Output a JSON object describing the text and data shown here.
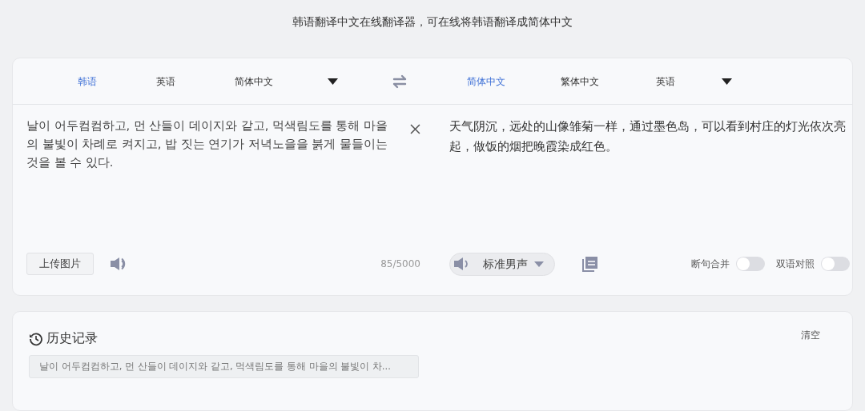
{
  "header": {
    "title": "韩语翻译中文在线翻译器，可在线将韩语翻译成简体中文"
  },
  "source_languages": [
    {
      "label": "韩语",
      "selected": true
    },
    {
      "label": "英语",
      "selected": false
    },
    {
      "label": "简体中文",
      "selected": false
    }
  ],
  "target_languages": [
    {
      "label": "简体中文",
      "selected": true
    },
    {
      "label": "繁体中文",
      "selected": false
    },
    {
      "label": "英语",
      "selected": false
    }
  ],
  "source": {
    "text": "날이 어두컴컴하고, 먼 산들이 데이지와 같고, 먹색림도를 통해 마을의 불빛이 차례로 켜지고, 밥 짓는 연기가 저녁노을을 붉게 물들이는 것을 볼 수 있다.",
    "upload_button": "上传图片",
    "char_count": "85/5000"
  },
  "target": {
    "text": "天气阴沉，远处的山像雏菊一样，通过墨色岛，可以看到村庄的灯光依次亮起，做饭的烟把晚霞染成红色。",
    "voice": "标准男声",
    "toggles": [
      {
        "label": "断句合并",
        "on": false
      },
      {
        "label": "双语对照",
        "on": false
      }
    ]
  },
  "history": {
    "title": "历史记录",
    "clear": "清空",
    "items": [
      "날이 어두컴컴하고, 먼 산들이 데이지와 같고, 먹색림도를 통해 마을의 불빛이 차..."
    ]
  }
}
